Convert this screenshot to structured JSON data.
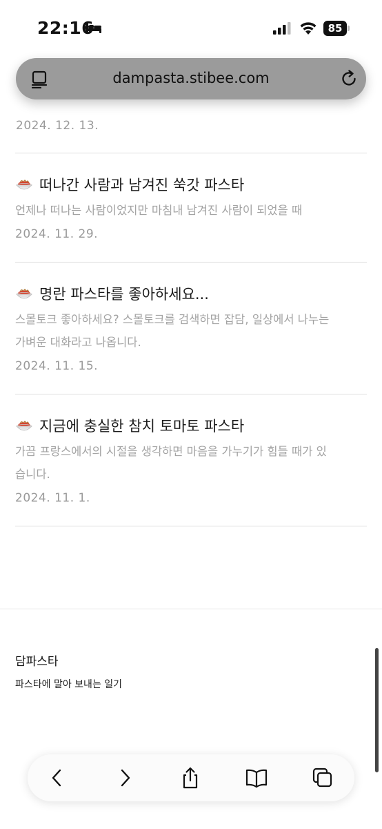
{
  "status": {
    "time": "22:16",
    "battery": "85"
  },
  "browser": {
    "url": "dampasta.stibee.com"
  },
  "list": {
    "prev_date": "2024. 12. 13.",
    "entries": [
      {
        "title": "떠나간 사람과 남겨진 쑥갓 파스타",
        "desc": [
          "언제나 떠나는 사람이었지만 마침내 남겨진 사람이 되었을 때"
        ],
        "date": "2024. 11. 29."
      },
      {
        "title": "명란 파스타를 좋아하세요...",
        "desc": [
          "스몰토크 좋아하세요? 스몰토크를 검색하면 잡담, 일상에서 나누는",
          "가벼운 대화라고 나옵니다."
        ],
        "date": "2024. 11. 15."
      },
      {
        "title": "지금에 충실한 참치 토마토 파스타",
        "desc": [
          "가끔 프랑스에서의 시절을 생각하면 마음을 가누기가 힘들 때가 있",
          "습니다."
        ],
        "date": "2024. 11. 1."
      }
    ]
  },
  "footer": {
    "title": "담파스타",
    "subtitle": "파스타에 말아 보내는 일기"
  },
  "colors": {
    "url_bar": "#9b9b9b",
    "meta_text": "#a3a3a3",
    "divider": "#dedede"
  }
}
